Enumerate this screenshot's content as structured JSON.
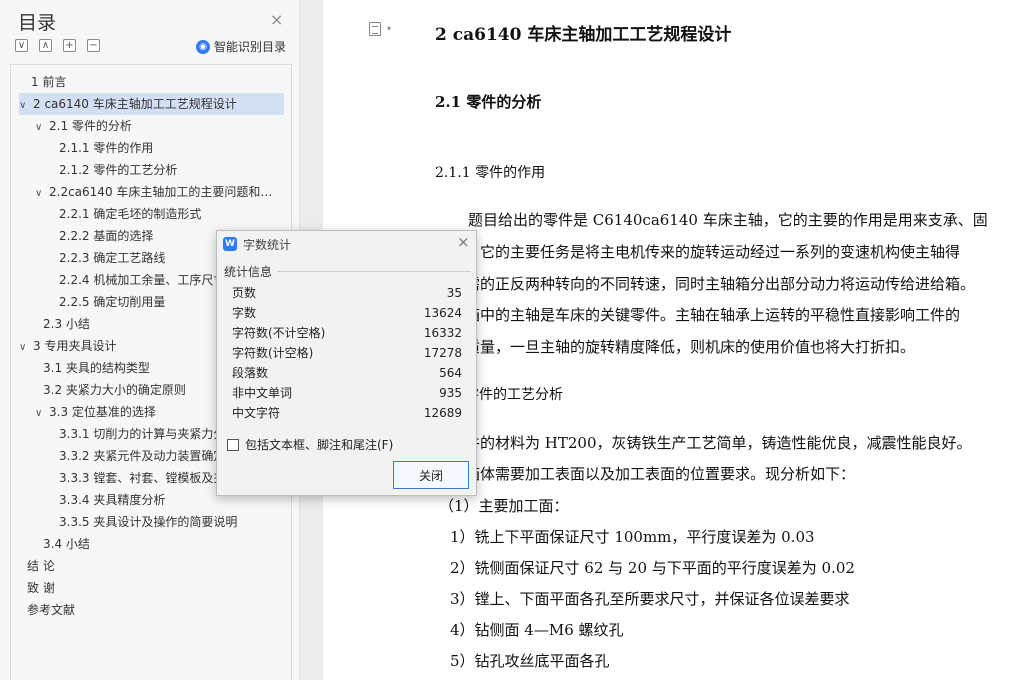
{
  "nav": {
    "title": "目录",
    "close_icon": "×",
    "tool_icons": [
      "∨",
      "∧",
      "+",
      "−"
    ],
    "ai_label": "智能识别目录",
    "toc": [
      {
        "label": "1  前言",
        "chev": ""
      },
      {
        "label": "2  ca6140 车床主轴加工工艺规程设计",
        "chev": "∨",
        "selected": true
      },
      {
        "label": "2.1 零件的分析",
        "chev": "∨"
      },
      {
        "label": "2.1.1 零件的作用",
        "chev": ""
      },
      {
        "label": "2.1.2 零件的工艺分析",
        "chev": ""
      },
      {
        "label": "2.2ca6140 车床主轴加工的主要问题和设计...",
        "chev": "∨"
      },
      {
        "label": "2.2.1 确定毛坯的制造形式",
        "chev": ""
      },
      {
        "label": "2.2.2 基面的选择",
        "chev": ""
      },
      {
        "label": "2.2.3 确定工艺路线",
        "chev": ""
      },
      {
        "label": "2.2.4 机械加工余量、工序尺寸及毛坯尺寸...",
        "chev": ""
      },
      {
        "label": "2.2.5 确定切削用量",
        "chev": ""
      },
      {
        "label": "2.3 小结",
        "chev": ""
      },
      {
        "label": "3  专用夹具设计",
        "chev": "∨"
      },
      {
        "label": "3.1 夹具的结构类型",
        "chev": ""
      },
      {
        "label": "3.2 夹紧力大小的确定原则",
        "chev": ""
      },
      {
        "label": "3.3 定位基准的选择",
        "chev": "∨"
      },
      {
        "label": "3.3.1 切削力的计算与夹紧力分析",
        "chev": ""
      },
      {
        "label": "3.3.2 夹紧元件及动力装置确定",
        "chev": ""
      },
      {
        "label": "3.3.3 镗套、衬套、镗模板及夹具体设计",
        "chev": ""
      },
      {
        "label": "3.3.4 夹具精度分析",
        "chev": ""
      },
      {
        "label": "3.3.5 夹具设计及操作的简要说明",
        "chev": ""
      },
      {
        "label": "3.4 小结",
        "chev": ""
      },
      {
        "label": "结  论",
        "chev": ""
      },
      {
        "label": "致  谢",
        "chev": ""
      },
      {
        "label": "参考文献",
        "chev": ""
      }
    ]
  },
  "doc": {
    "h1": "2 ca6140 车床主轴加工工艺规程设计",
    "h2": "2.1 零件的分析",
    "h3a": "2.1.1 零件的作用",
    "p1": "题目给出的零件是 C6140ca6140 车床主轴，它的主要的作用是用来支承、固",
    "p2": "，它的主要任务是将主电机传来的旋转运动经过一系列的变速机构使主轴得",
    "p3": "需的正反两种转向的不同转速，同时主轴箱分出部分动力将运动传给进给箱。",
    "p4": "箱中的主轴是车床的关键零件。主轴在轴承上运转的平稳性直接影响工件的",
    "p5": "质量，一旦主轴的旋转精度降低，则机床的使用价值也将大打折扣。",
    "h3b": "零件的工艺分析",
    "p6": "件的材料为 HT200，灰铸铁生产工艺简单，铸造性能优良，减震性能良好。",
    "p7": "箱体需要加工表面以及加工表面的位置要求。现分析如下：",
    "l0": "（1）主要加工面：",
    "l1": "1）铣上下平面保证尺寸 100mm，平行度误差为 0.03",
    "l2": "2）铣侧面保证尺寸 62 与 20 与下平面的平行度误差为 0.02",
    "l3": "3）镗上、下面平面各孔至所要求尺寸，并保证各位误差要求",
    "l4": "4）钻侧面 4—M6 螺纹孔",
    "l5": "5）钻孔攻丝底平面各孔"
  },
  "dialog": {
    "logo": "W",
    "title": "字数统计",
    "close_icon": "×",
    "group_label": "统计信息",
    "stats": [
      {
        "label": "页数",
        "value": "35"
      },
      {
        "label": "字数",
        "value": "13624"
      },
      {
        "label": "字符数(不计空格)",
        "value": "16332"
      },
      {
        "label": "字符数(计空格)",
        "value": "17278"
      },
      {
        "label": "段落数",
        "value": "564"
      },
      {
        "label": "非中文单词",
        "value": "935"
      },
      {
        "label": "中文字符",
        "value": "12689"
      }
    ],
    "checkbox_label": "包括文本框、脚注和尾注(F)",
    "checkbox_checked": false,
    "close_button": "关闭"
  },
  "colors": {
    "accent": "#2f7bf6",
    "selection": "#d3e0f4"
  }
}
